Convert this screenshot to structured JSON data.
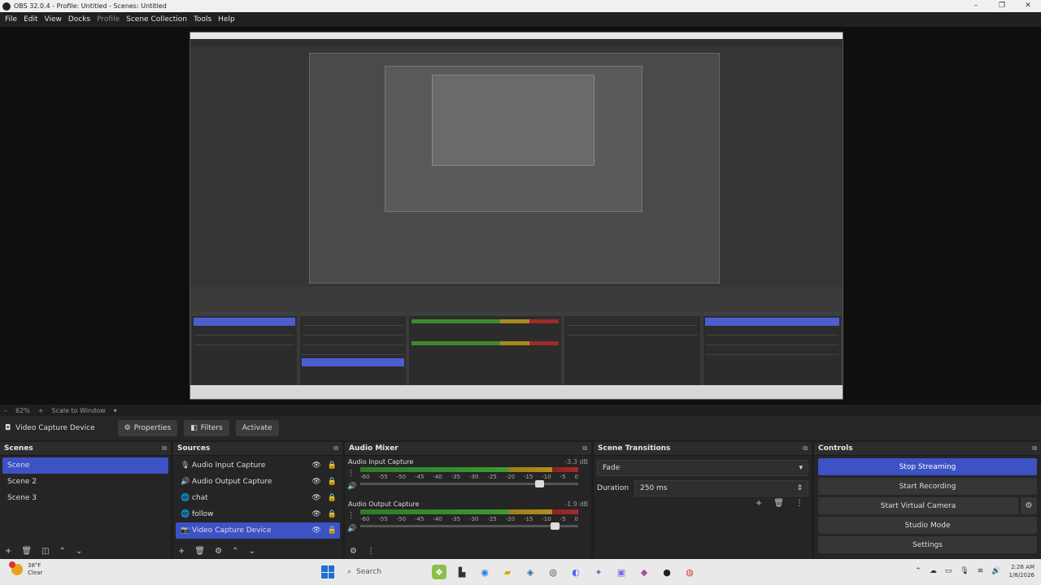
{
  "window": {
    "title": "OBS 32.0.4 - Profile: Untitled - Scenes: Untitled",
    "controls": [
      "–",
      "❐",
      "✕"
    ]
  },
  "menu": {
    "items": [
      "File",
      "Edit",
      "View",
      "Docks",
      "Profile",
      "Scene Collection",
      "Tools",
      "Help"
    ]
  },
  "preview_toolbar": {
    "zoom": "62%",
    "scale_mode": "Scale to Window"
  },
  "source_toolbar": {
    "source_name": "Video Capture Device",
    "properties_label": "Properties",
    "filters_label": "Filters",
    "activate_label": "Activate"
  },
  "scenes": {
    "title": "Scenes",
    "items": [
      "Scene",
      "Scene 2",
      "Scene 3"
    ],
    "selected": "Scene"
  },
  "sources": {
    "title": "Sources",
    "items": [
      {
        "label": "Audio Input Capture",
        "icon": "microphone-icon"
      },
      {
        "label": "Audio Output Capture",
        "icon": "speaker-icon"
      },
      {
        "label": "chat",
        "icon": "browser-icon"
      },
      {
        "label": "follow",
        "icon": "browser-icon"
      },
      {
        "label": "Video Capture Device",
        "icon": "camera-icon"
      }
    ],
    "selected": "Video Capture Device"
  },
  "audio_mixer": {
    "title": "Audio Mixer",
    "channels": [
      {
        "name": "Audio Input Capture",
        "db": "-3.3 dB",
        "fader": 0.82
      },
      {
        "name": "Audio Output Capture",
        "db": "-1.9 dB",
        "fader": 0.89
      }
    ],
    "ticks": [
      "-60",
      "-55",
      "-50",
      "-45",
      "-40",
      "-35",
      "-30",
      "-25",
      "-20",
      "-15",
      "-10",
      "-5",
      "0"
    ]
  },
  "scene_transitions": {
    "title": "Scene Transitions",
    "transition": "Fade",
    "duration_label": "Duration",
    "duration_value": "250 ms"
  },
  "controls": {
    "title": "Controls",
    "stop_streaming": "Stop Streaming",
    "start_recording": "Start Recording",
    "start_virtual_camera": "Start Virtual Camera",
    "studio_mode": "Studio Mode",
    "settings": "Settings"
  },
  "taskbar": {
    "temperature": "38°F",
    "weather": "Clear",
    "search_placeholder": "Search",
    "time": "2:26 AM",
    "date": "1/8/2026"
  },
  "colors": {
    "accent": "#3d52c4",
    "panel": "#252525",
    "background": "#1e1e1e"
  }
}
